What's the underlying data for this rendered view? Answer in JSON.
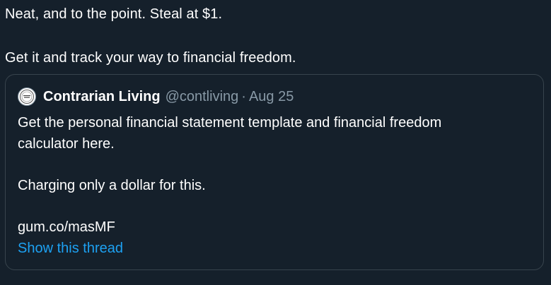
{
  "tweet": {
    "line1": "Neat, and to the point. Steal at $1.",
    "line2": "Get it and track your way to financial freedom."
  },
  "quote": {
    "author_name": "Contrarian Living",
    "author_handle": "@contliving",
    "separator": "·",
    "date": "Aug 25",
    "avatar_icon": "seal-logo-icon",
    "body_line1": "Get the personal financial statement template and financial freedom",
    "body_line2": "calculator here.",
    "body_line3": "Charging only a dollar for this.",
    "link": "gum.co/masMF",
    "show_thread": "Show this thread"
  },
  "colors": {
    "background": "#15202b",
    "text": "#ffffff",
    "muted": "#8899a6",
    "border": "#38444d",
    "link": "#1da1f2"
  }
}
